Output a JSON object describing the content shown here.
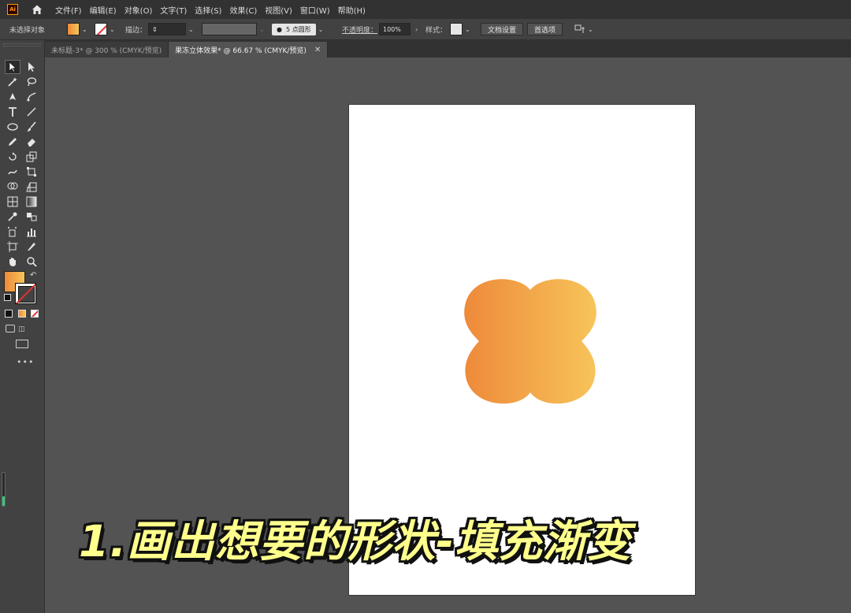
{
  "menubar": {
    "logo_text": "Ai",
    "items": [
      "文件(F)",
      "编辑(E)",
      "对象(O)",
      "文字(T)",
      "选择(S)",
      "效果(C)",
      "视图(V)",
      "窗口(W)",
      "帮助(H)"
    ]
  },
  "controlbar": {
    "selection_label": "未选择对象",
    "stroke_label": "描边：",
    "brush_label": "5 点圆形",
    "opacity_label": "不透明度：",
    "opacity_value": "100%",
    "style_label": "样式：",
    "doc_setup_label": "文档设置",
    "preferences_label": "首选项"
  },
  "tabs": [
    {
      "label": "未标题-3* @ 300 % (CMYK/预览)",
      "active": false
    },
    {
      "label": "果冻立体效果* @ 66.67 % (CMYK/预览)",
      "active": true
    }
  ],
  "caption": "1.画出想要的形状-填充渐变",
  "colors": {
    "gradient_start": "#ee8a3a",
    "gradient_end": "#f7c45a",
    "caption_color": "#ffff8c"
  }
}
